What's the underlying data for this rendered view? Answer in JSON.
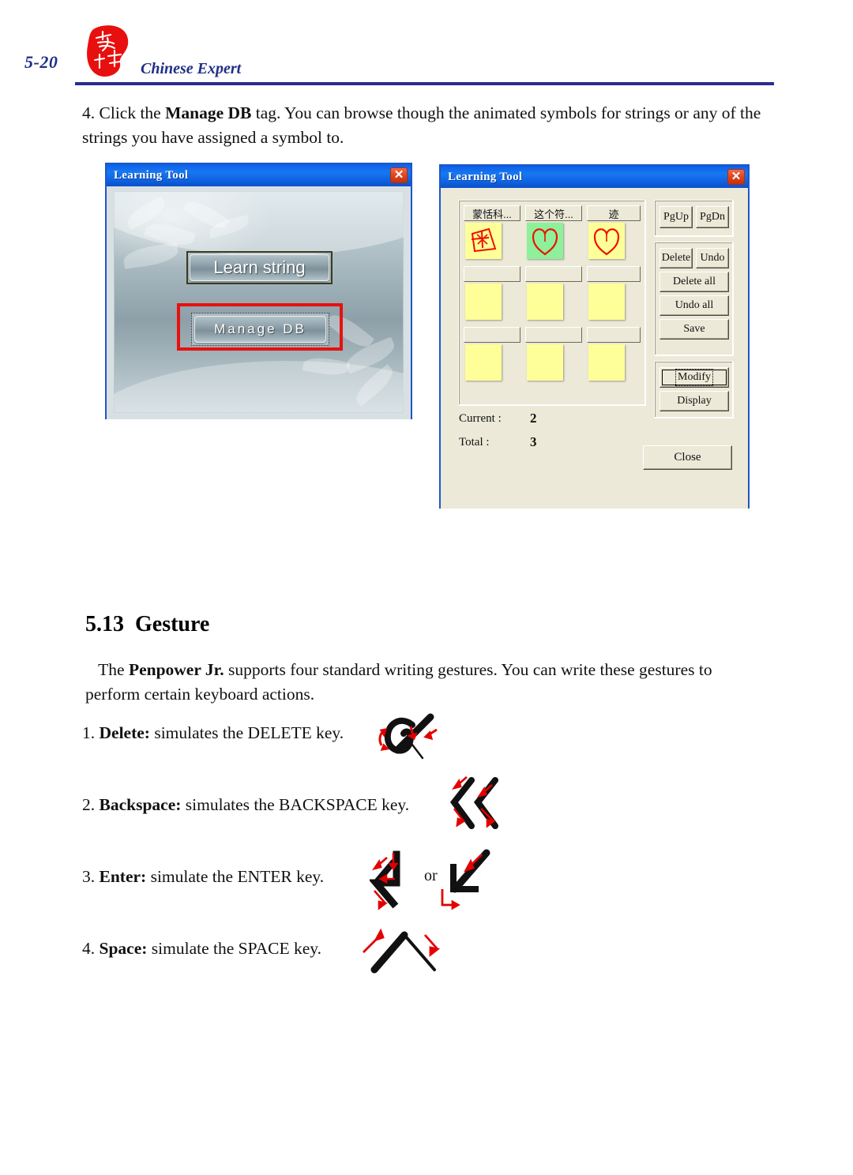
{
  "header": {
    "page_number": "5-20",
    "title": "Chinese Expert",
    "logo_icon": "seal-logo-icon"
  },
  "step4": {
    "number": "4.",
    "text_before": "Click the ",
    "bold": "Manage DB",
    "text_after": " tag. You can browse though the animated symbols for strings or any of the strings you have assigned a symbol to."
  },
  "dialog1": {
    "title": "Learning Tool",
    "close_icon": "close-icon",
    "learn_string_button": "Learn string",
    "manage_db_button": "Manage DB",
    "highlight_color": "#e8100f"
  },
  "dialog2": {
    "title": "Learning Tool",
    "close_icon": "close-icon",
    "grid": [
      [
        {
          "label": "蒙恬科...",
          "symbol": "square-star-symbol",
          "bg": "#ffff99"
        },
        {
          "label": "这个符...",
          "symbol": "heart-symbol",
          "bg": "#8ef09a"
        },
        {
          "label": "迹",
          "symbol": "heart-symbol",
          "bg": "#ffff99"
        }
      ],
      [
        {
          "label": "",
          "symbol": "",
          "bg": "#ffff99"
        },
        {
          "label": "",
          "symbol": "",
          "bg": "#ffff99"
        },
        {
          "label": "",
          "symbol": "",
          "bg": "#ffff99"
        }
      ],
      [
        {
          "label": "",
          "symbol": "",
          "bg": "#ffff99"
        },
        {
          "label": "",
          "symbol": "",
          "bg": "#ffff99"
        },
        {
          "label": "",
          "symbol": "",
          "bg": "#ffff99"
        }
      ]
    ],
    "buttons": {
      "pgup": "PgUp",
      "pgdn": "PgDn",
      "delete": "Delete",
      "undo": "Undo",
      "delete_all": "Delete all",
      "undo_all": "Undo all",
      "save": "Save",
      "modify": "Modify",
      "display": "Display",
      "close": "Close"
    },
    "status": {
      "current_label": "Current :",
      "current_value": "2",
      "total_label": "Total :",
      "total_value": "3"
    }
  },
  "section": {
    "number": "5.13",
    "title": "Gesture",
    "intro_before": "The ",
    "intro_bold": "Penpower Jr.",
    "intro_after": " supports four standard writing gestures. You can write these gestures to perform certain keyboard actions."
  },
  "gestures": [
    {
      "number": "1.",
      "name": "Delete:",
      "desc": " simulates the DELETE key.",
      "icon": "delete-gesture-icon"
    },
    {
      "number": "2.",
      "name": "Backspace:",
      "desc": " simulates the BACKSPACE key.",
      "icon": "backspace-gesture-icon"
    },
    {
      "number": "3.",
      "name": "Enter:",
      "desc": " simulate the ENTER key.",
      "icon": "enter-gesture-icon",
      "or_text": "or",
      "icon2": "enter-gesture-alt-icon"
    },
    {
      "number": "4.",
      "name": "Space:",
      "desc": " simulate the SPACE key.",
      "icon": "space-gesture-icon"
    }
  ]
}
